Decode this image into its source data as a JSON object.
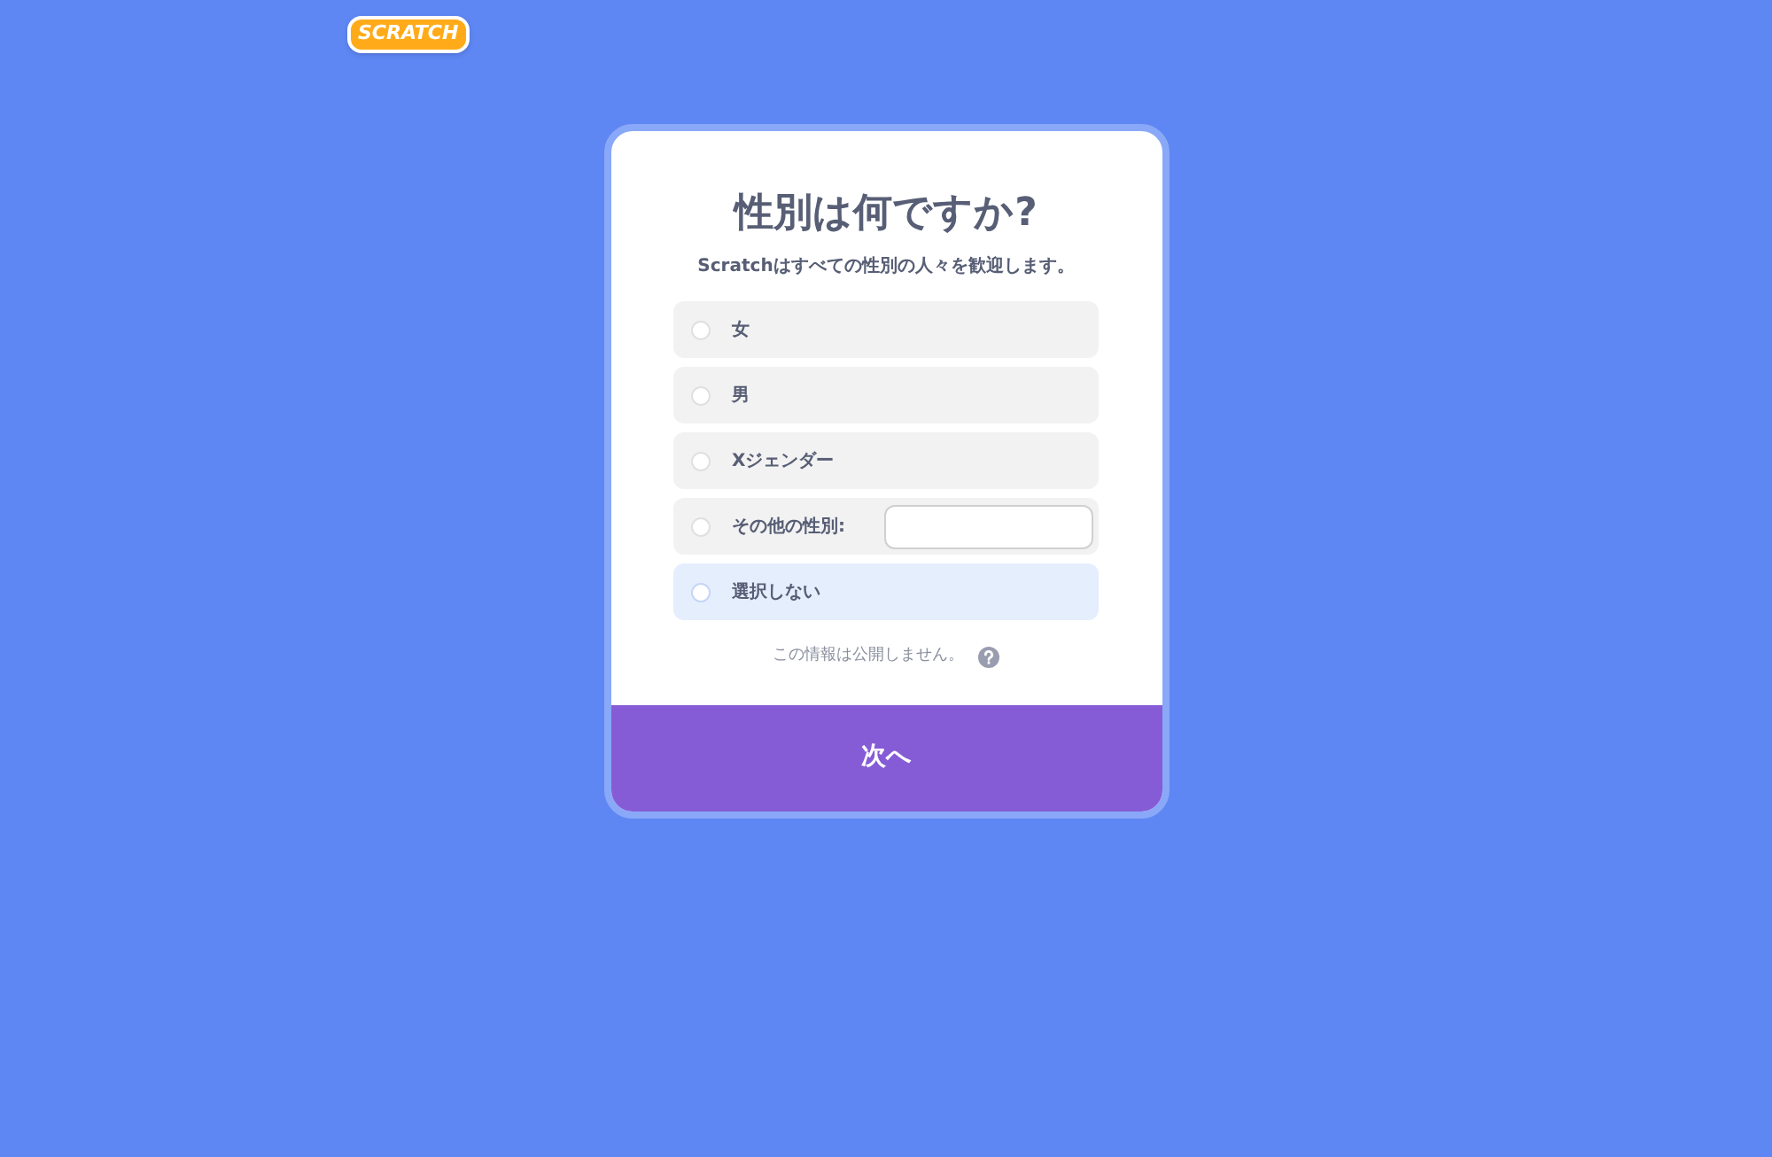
{
  "logo": "SCRATCH",
  "dialog": {
    "title": "性別は何ですか?",
    "subtitle": "Scratchはすべての性別の人々を歓迎します。",
    "options": [
      {
        "kind": "plain",
        "label": "女",
        "selected": false
      },
      {
        "kind": "plain",
        "label": "男",
        "selected": false
      },
      {
        "kind": "plain",
        "label": "Xジェンダー",
        "selected": false
      },
      {
        "kind": "other",
        "label": "その他の性別:",
        "selected": false
      },
      {
        "kind": "plain",
        "label": "選択しない",
        "selected": true
      }
    ],
    "privacy_note": "この情報は公開しません。",
    "next_button": "次へ"
  }
}
